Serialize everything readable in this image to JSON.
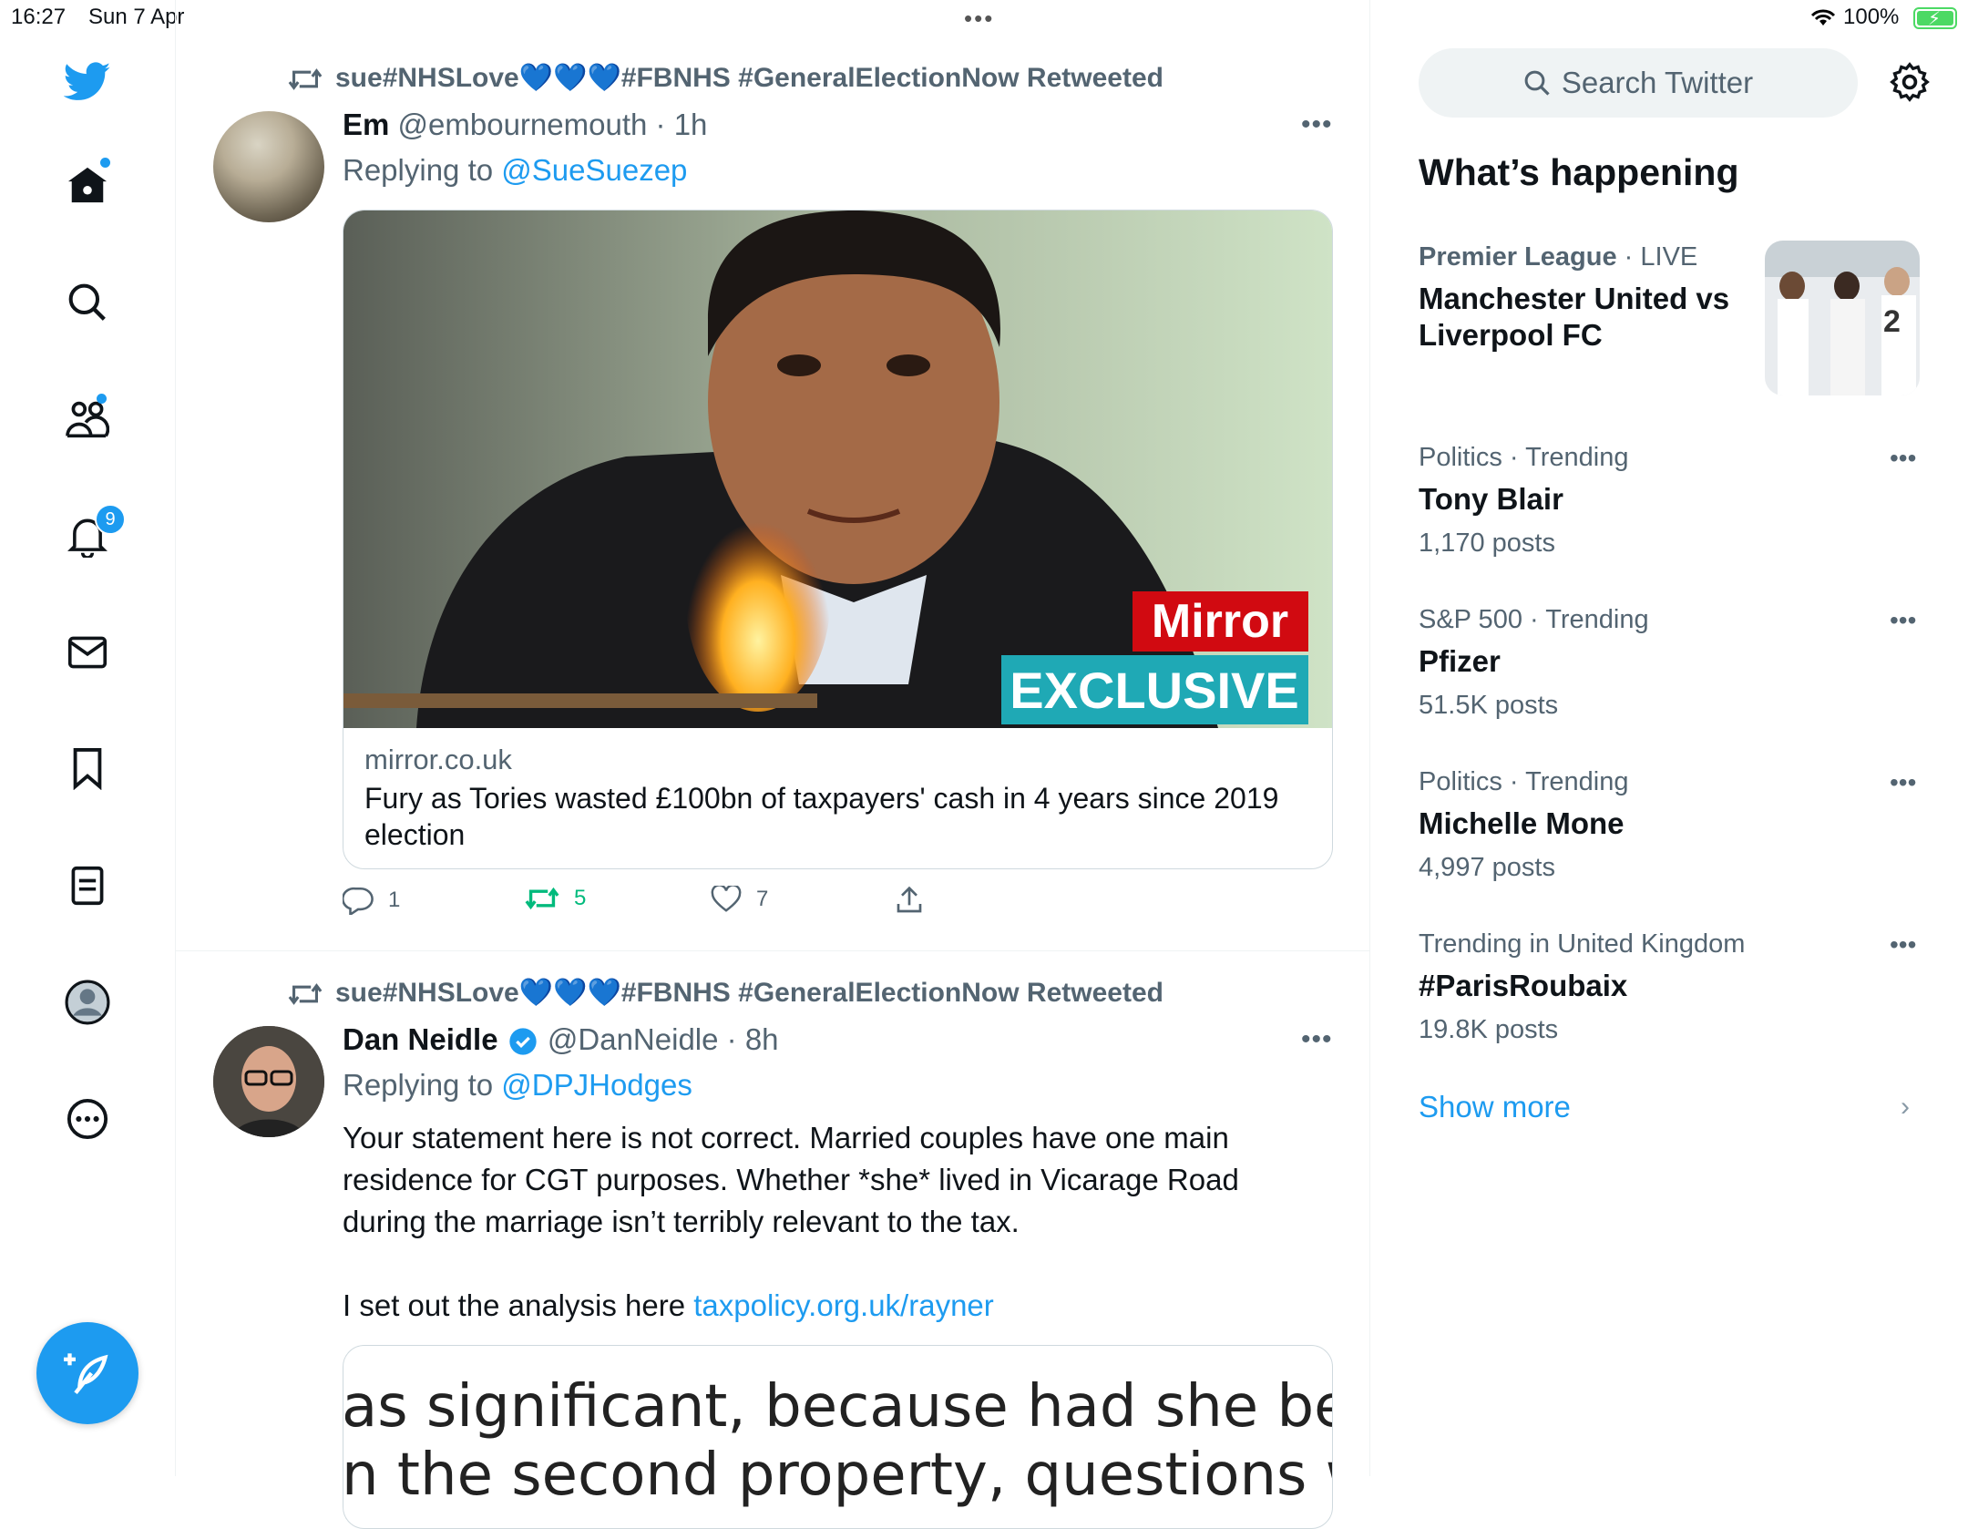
{
  "status_bar": {
    "time": "16:27",
    "date": "Sun 7 Apr",
    "battery": "100%"
  },
  "nav": {
    "items": [
      {
        "name": "twitter-logo",
        "icon": "bird-icon"
      },
      {
        "name": "home",
        "icon": "home-icon"
      },
      {
        "name": "explore",
        "icon": "search-icon"
      },
      {
        "name": "communities",
        "icon": "people-icon"
      },
      {
        "name": "notifications",
        "icon": "bell-icon",
        "badge": "9"
      },
      {
        "name": "messages",
        "icon": "envelope-icon"
      },
      {
        "name": "bookmarks",
        "icon": "bookmark-icon"
      },
      {
        "name": "lists",
        "icon": "list-icon"
      },
      {
        "name": "profile",
        "icon": "avatar-icon"
      },
      {
        "name": "more",
        "icon": "more-circle-icon"
      }
    ],
    "notification_badge": "9"
  },
  "tweets": [
    {
      "retweeted_by": "sue#NHSLove💙💙💙#FBNHS #GeneralElectionNow Retweeted",
      "name": "Em",
      "handle": "@embournemouth",
      "time": "· 1h",
      "replying_prefix": "Replying to ",
      "replying_to": "@SueSuezep",
      "card": {
        "badge_top": "Mirror",
        "badge_bottom": "EXCLUSIVE",
        "domain": "mirror.co.uk",
        "title": "Fury as Tories wasted £100bn of taxpayers' cash in 4 years since 2019 election"
      },
      "replies": "1",
      "retweets": "5",
      "likes": "7"
    },
    {
      "retweeted_by": "sue#NHSLove💙💙💙#FBNHS #GeneralElectionNow Retweeted",
      "name": "Dan Neidle",
      "handle": "@DanNeidle",
      "time": "· 8h",
      "replying_prefix": "Replying to ",
      "replying_to": "@DPJHodges",
      "text": "Your statement here is not correct. Married couples have one main residence for CGT purposes. Whether *she* lived in Vicarage Road during the marriage isn’t terribly relevant to the tax.",
      "text2_prefix": "I set out the analysis here ",
      "text2_link": "taxpolicy.org.uk/rayner",
      "card_line1": "as significant, because had she bee",
      "card_line2": "n the second property, questions wo"
    }
  ],
  "sidebar": {
    "search_placeholder": "Search Twitter",
    "whats_happening": "What’s happening",
    "trends": [
      {
        "category": "Premier League",
        "meta": " · LIVE",
        "name": "Manchester United vs Liverpool FC",
        "count": ""
      },
      {
        "category": "Politics · Trending",
        "meta": "",
        "name": "Tony Blair",
        "count": "1,170 posts"
      },
      {
        "category": "S&P 500 · Trending",
        "meta": "",
        "name": "Pfizer",
        "count": "51.5K posts"
      },
      {
        "category": "Politics · Trending",
        "meta": "",
        "name": "Michelle Mone",
        "count": "4,997 posts"
      },
      {
        "category": "Trending in United Kingdom",
        "meta": "",
        "name": "#ParisRoubaix",
        "count": "19.8K posts"
      }
    ],
    "show_more": "Show more"
  },
  "colors": {
    "accent": "#1d9bf0",
    "secondary_text": "#536471",
    "retweet_green": "#00ba7c"
  }
}
